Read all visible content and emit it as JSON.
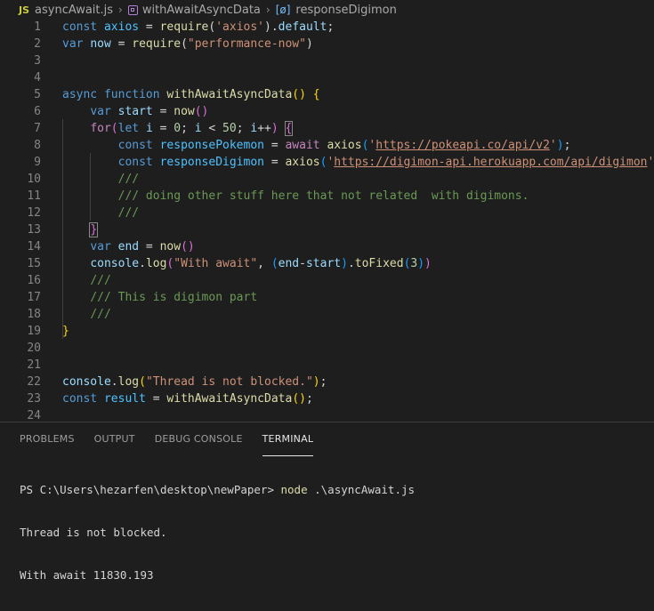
{
  "breadcrumb": {
    "lang_icon": "JS",
    "file": "asyncAwait.js",
    "function": "withAwaitAsyncData",
    "symbol": "responseDigimon"
  },
  "editor": {
    "lines": [
      {
        "n": "1",
        "tokens": [
          [
            "kw",
            "const "
          ],
          [
            "const",
            "axios"
          ],
          [
            "pu",
            " = "
          ],
          [
            "fn",
            "require"
          ],
          [
            "pu",
            "("
          ],
          [
            "str",
            "'axios'"
          ],
          [
            "pu",
            ")."
          ],
          [
            "var",
            "default"
          ],
          [
            "pu",
            ";"
          ]
        ]
      },
      {
        "n": "2",
        "tokens": [
          [
            "kw",
            "var "
          ],
          [
            "var",
            "now"
          ],
          [
            "pu",
            " = "
          ],
          [
            "fn",
            "require"
          ],
          [
            "pu",
            "("
          ],
          [
            "str",
            "\"performance-now\""
          ],
          [
            "pu",
            ")"
          ]
        ]
      },
      {
        "n": "3",
        "tokens": []
      },
      {
        "n": "4",
        "tokens": []
      },
      {
        "n": "5",
        "tokens": [
          [
            "kw",
            "async function "
          ],
          [
            "fn",
            "withAwaitAsyncData"
          ],
          [
            "b1",
            "() {"
          ]
        ]
      },
      {
        "n": "6",
        "tokens": [
          [
            "pu",
            "    "
          ],
          [
            "kw",
            "var "
          ],
          [
            "var",
            "start"
          ],
          [
            "pu",
            " = "
          ],
          [
            "fn",
            "now"
          ],
          [
            "b2",
            "()"
          ]
        ]
      },
      {
        "n": "7",
        "tokens": [
          [
            "pu",
            "    "
          ],
          [
            "ctl",
            "for"
          ],
          [
            "b2",
            "("
          ],
          [
            "kw",
            "let "
          ],
          [
            "var",
            "i"
          ],
          [
            "pu",
            " = "
          ],
          [
            "num",
            "0"
          ],
          [
            "pu",
            "; "
          ],
          [
            "var",
            "i"
          ],
          [
            "pu",
            " < "
          ],
          [
            "num",
            "50"
          ],
          [
            "pu",
            "; "
          ],
          [
            "var",
            "i"
          ],
          [
            "pu",
            "++"
          ],
          [
            "b2",
            ")"
          ],
          [
            "pu",
            " "
          ],
          [
            "b2m",
            "{"
          ]
        ]
      },
      {
        "n": "8",
        "tokens": [
          [
            "pu",
            "        "
          ],
          [
            "kw",
            "const "
          ],
          [
            "const",
            "responsePokemon"
          ],
          [
            "pu",
            " = "
          ],
          [
            "ctl",
            "await "
          ],
          [
            "fn",
            "axios"
          ],
          [
            "b3",
            "("
          ],
          [
            "str",
            "'"
          ],
          [
            "url",
            "https://pokeapi.co/api/v2"
          ],
          [
            "str",
            "'"
          ],
          [
            "b3",
            ")"
          ],
          [
            "pu",
            ";"
          ]
        ]
      },
      {
        "n": "9",
        "tokens": [
          [
            "pu",
            "        "
          ],
          [
            "kw",
            "const "
          ],
          [
            "const",
            "responseDigimon"
          ],
          [
            "pu",
            " = "
          ],
          [
            "fn",
            "axios"
          ],
          [
            "b3",
            "("
          ],
          [
            "str",
            "'"
          ],
          [
            "url",
            "https://digimon-api.herokuapp.com/api/digimon"
          ],
          [
            "str",
            "'"
          ],
          [
            "b3",
            ")"
          ]
        ]
      },
      {
        "n": "10",
        "tokens": [
          [
            "pu",
            "        "
          ],
          [
            "cm",
            "///"
          ]
        ]
      },
      {
        "n": "11",
        "tokens": [
          [
            "pu",
            "        "
          ],
          [
            "cm",
            "/// doing other stuff here that not related  with digimons."
          ]
        ]
      },
      {
        "n": "12",
        "tokens": [
          [
            "pu",
            "        "
          ],
          [
            "cm",
            "///"
          ]
        ]
      },
      {
        "n": "13",
        "tokens": [
          [
            "pu",
            "    "
          ],
          [
            "b2m",
            "}"
          ]
        ]
      },
      {
        "n": "14",
        "tokens": [
          [
            "pu",
            "    "
          ],
          [
            "kw",
            "var "
          ],
          [
            "var",
            "end"
          ],
          [
            "pu",
            " = "
          ],
          [
            "fn",
            "now"
          ],
          [
            "b2",
            "()"
          ]
        ]
      },
      {
        "n": "15",
        "tokens": [
          [
            "pu",
            "    "
          ],
          [
            "var",
            "console"
          ],
          [
            "pu",
            "."
          ],
          [
            "fn",
            "log"
          ],
          [
            "b2",
            "("
          ],
          [
            "str",
            "\"With await\""
          ],
          [
            "pu",
            ", "
          ],
          [
            "b3",
            "("
          ],
          [
            "var",
            "end"
          ],
          [
            "pu",
            "-"
          ],
          [
            "var",
            "start"
          ],
          [
            "b3",
            ")"
          ],
          [
            "pu",
            "."
          ],
          [
            "fn",
            "toFixed"
          ],
          [
            "b3",
            "("
          ],
          [
            "num",
            "3"
          ],
          [
            "b3",
            ")"
          ],
          [
            "b2",
            ")"
          ]
        ]
      },
      {
        "n": "16",
        "tokens": [
          [
            "pu",
            "    "
          ],
          [
            "cm",
            "///"
          ]
        ]
      },
      {
        "n": "17",
        "tokens": [
          [
            "pu",
            "    "
          ],
          [
            "cm",
            "/// This is digimon part"
          ]
        ]
      },
      {
        "n": "18",
        "tokens": [
          [
            "pu",
            "    "
          ],
          [
            "cm",
            "///"
          ]
        ]
      },
      {
        "n": "19",
        "tokens": [
          [
            "b1",
            "}"
          ]
        ]
      },
      {
        "n": "20",
        "tokens": []
      },
      {
        "n": "21",
        "tokens": []
      },
      {
        "n": "22",
        "tokens": [
          [
            "var",
            "console"
          ],
          [
            "pu",
            "."
          ],
          [
            "fn",
            "log"
          ],
          [
            "b1",
            "("
          ],
          [
            "str",
            "\"Thread is not blocked.\""
          ],
          [
            "b1",
            ")"
          ],
          [
            "pu",
            ";"
          ]
        ]
      },
      {
        "n": "23",
        "tokens": [
          [
            "kw",
            "const "
          ],
          [
            "const",
            "result"
          ],
          [
            "pu",
            " = "
          ],
          [
            "fn",
            "withAwaitAsyncData"
          ],
          [
            "b1",
            "()"
          ],
          [
            "pu",
            ";"
          ]
        ]
      },
      {
        "n": "24",
        "tokens": []
      }
    ]
  },
  "panel": {
    "tabs": [
      "PROBLEMS",
      "OUTPUT",
      "DEBUG CONSOLE",
      "TERMINAL"
    ],
    "active_tab": "TERMINAL",
    "terminal": {
      "prompt": "PS C:\\Users\\hezarfen\\desktop\\newPaper> ",
      "command": "node",
      "args": " .\\asyncAwait.js",
      "output": [
        "Thread is not blocked.",
        "With await 11830.193"
      ]
    }
  }
}
